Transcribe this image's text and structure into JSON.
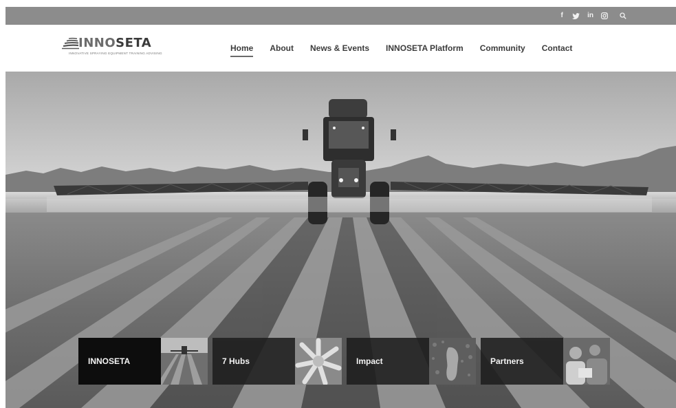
{
  "social": {
    "icons": [
      "facebook-icon",
      "twitter-icon",
      "linkedin-icon",
      "instagram-icon",
      "search-icon"
    ],
    "facebook": "f",
    "linkedin": "in"
  },
  "logo": {
    "name_light": "INNO",
    "name_bold": "SETA",
    "tagline": "INNOVATIVE SPRAYING EQUIPMENT TRAINING ADVISING"
  },
  "nav": {
    "items": [
      {
        "label": "Home",
        "active": true
      },
      {
        "label": "About"
      },
      {
        "label": "News & Events"
      },
      {
        "label": "INNOSETA Platform"
      },
      {
        "label": "Community"
      },
      {
        "label": "Contact"
      }
    ]
  },
  "cards": [
    {
      "label": "INNOSETA",
      "thumb": "field-rows-thumbnail"
    },
    {
      "label": "7 Hubs",
      "thumb": "hands-circle-thumbnail"
    },
    {
      "label": "Impact",
      "thumb": "footprint-thumbnail"
    },
    {
      "label": "Partners",
      "thumb": "people-thumbnail"
    }
  ],
  "colors": {
    "topbar": "#8c8c8c",
    "nav_text": "#3c3c3c",
    "card_dark": "#0d0d0d"
  }
}
